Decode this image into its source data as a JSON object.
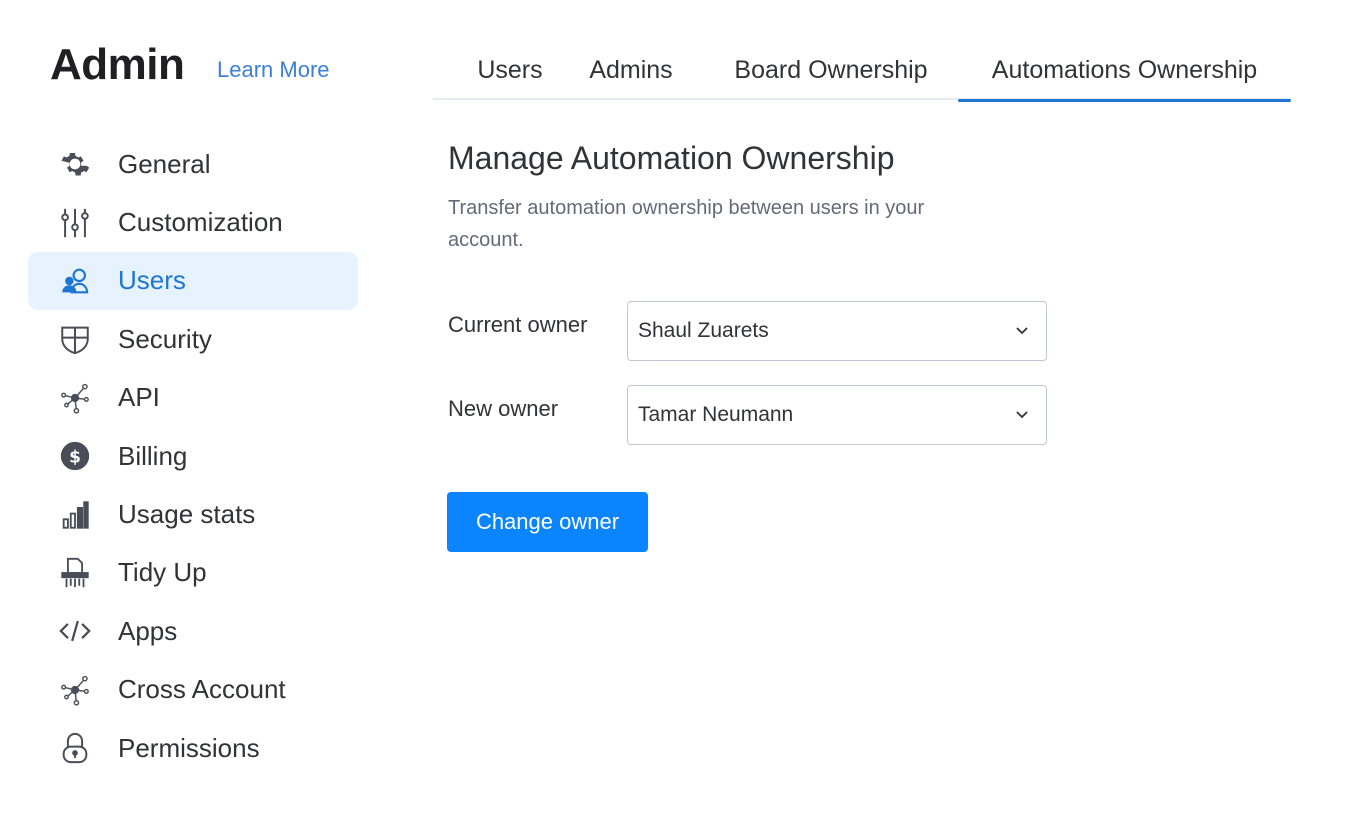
{
  "header": {
    "title": "Admin",
    "learn_more": "Learn More"
  },
  "sidebar": {
    "items": [
      {
        "label": "General",
        "icon": "gear-icon",
        "active": false
      },
      {
        "label": "Customization",
        "icon": "sliders-icon",
        "active": false
      },
      {
        "label": "Users",
        "icon": "users-icon",
        "active": true
      },
      {
        "label": "Security",
        "icon": "shield-icon",
        "active": false
      },
      {
        "label": "API",
        "icon": "network-icon",
        "active": false
      },
      {
        "label": "Billing",
        "icon": "dollar-coin-icon",
        "active": false
      },
      {
        "label": "Usage stats",
        "icon": "bar-chart-icon",
        "active": false
      },
      {
        "label": "Tidy Up",
        "icon": "shredder-icon",
        "active": false
      },
      {
        "label": "Apps",
        "icon": "code-icon",
        "active": false
      },
      {
        "label": "Cross Account",
        "icon": "network-icon",
        "active": false
      },
      {
        "label": "Permissions",
        "icon": "lock-icon",
        "active": false
      }
    ]
  },
  "tabs": [
    {
      "label": "Users",
      "active": false
    },
    {
      "label": "Admins",
      "active": false
    },
    {
      "label": "Board Ownership",
      "active": false
    },
    {
      "label": "Automations Ownership",
      "active": true
    }
  ],
  "main": {
    "title": "Manage Automation Ownership",
    "description": "Transfer automation ownership between users in your account.",
    "current_owner_label": "Current owner",
    "current_owner_value": "Shaul Zuarets",
    "new_owner_label": "New owner",
    "new_owner_value": "Tamar Neumann",
    "change_owner_button": "Change owner"
  },
  "colors": {
    "accent": "#1f76d2",
    "active_bg": "#e6f2fd",
    "button": "#0a84ff",
    "link": "#3d7fd6"
  }
}
